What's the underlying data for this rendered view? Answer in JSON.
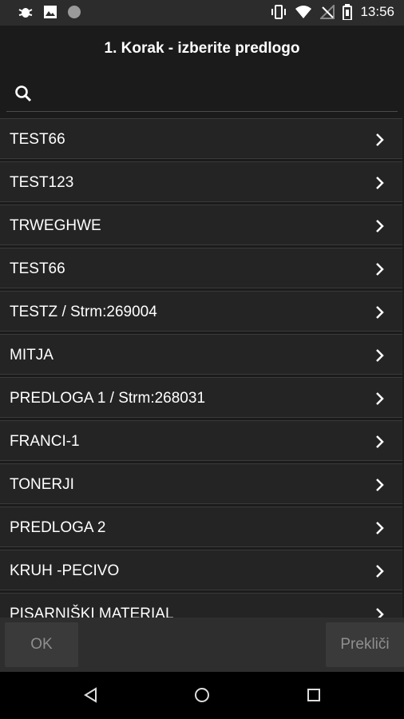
{
  "status_bar": {
    "time": "13:56",
    "left_icons": [
      "bug-icon",
      "image-icon",
      "circle-icon"
    ],
    "right_icons": [
      "vibrate-icon",
      "wifi-icon",
      "no-signal-icon",
      "battery-icon"
    ]
  },
  "header": {
    "title": "1. Korak - izberite predlogo"
  },
  "search": {
    "value": "",
    "placeholder": ""
  },
  "list": {
    "items": [
      {
        "label": "TEST66"
      },
      {
        "label": "TEST123"
      },
      {
        "label": "TRWEGHWE"
      },
      {
        "label": "TEST66"
      },
      {
        "label": "TESTZ / Strm:269004"
      },
      {
        "label": "MITJA"
      },
      {
        "label": "PREDLOGA 1 / Strm:268031"
      },
      {
        "label": "FRANCI-1"
      },
      {
        "label": "TONERJI"
      },
      {
        "label": "PREDLOGA 2"
      },
      {
        "label": "KRUH -PECIVO"
      },
      {
        "label": "PISARNIŠKI MATERIAL"
      }
    ]
  },
  "actions": {
    "ok_label": "OK",
    "cancel_label": "Prekliči"
  },
  "colors": {
    "background": "#1b1b1b",
    "item_background": "#242424",
    "button_text": "#8f8f8f"
  }
}
